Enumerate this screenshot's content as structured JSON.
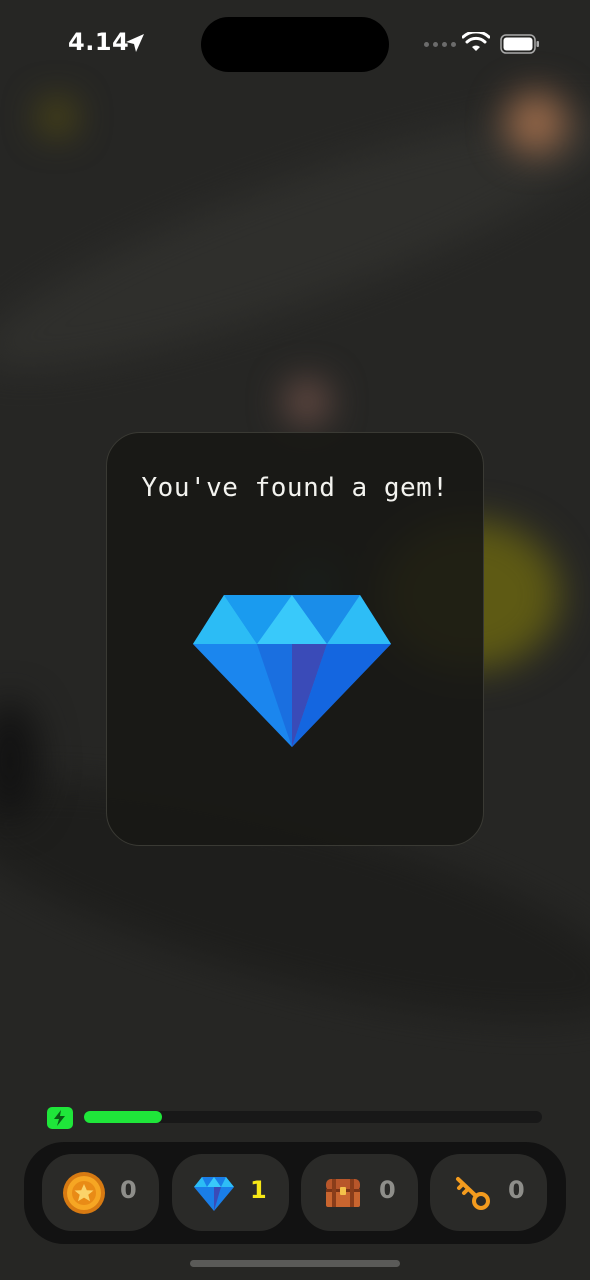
{
  "status_bar": {
    "time": "4.14"
  },
  "dialog": {
    "title": "You've found a gem!",
    "icon": "diamond-gem-icon"
  },
  "energy": {
    "level": 0.17,
    "color": "#1fe63a"
  },
  "inventory": [
    {
      "name": "coin",
      "icon": "coin-icon",
      "count": "0",
      "count_color": "#8e8e8a"
    },
    {
      "name": "gem",
      "icon": "gem-icon",
      "count": "1",
      "count_color": "#f6e716"
    },
    {
      "name": "chest",
      "icon": "treasure-chest-icon",
      "count": "0",
      "count_color": "#8e8e8a"
    },
    {
      "name": "key",
      "icon": "key-icon",
      "count": "0",
      "count_color": "#8e8e8a"
    }
  ]
}
